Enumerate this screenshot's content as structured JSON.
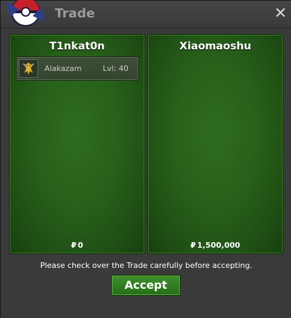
{
  "window": {
    "title": "Trade",
    "close_icon": "close-icon",
    "logo_icon": "pokeball-logo-icon"
  },
  "trade": {
    "left": {
      "player": "T1nkat0n",
      "items": [
        {
          "name": "Alakazam",
          "level": "Lvl: 40",
          "icon": "alakazam-sprite-icon"
        }
      ],
      "currency_symbol": "₽",
      "money": "0"
    },
    "right": {
      "player": "Xiaomaoshu",
      "items": [],
      "currency_symbol": "₽",
      "money": "1,500,000"
    }
  },
  "notice": "Please check over the Trade carefully before accepting.",
  "accept_label": "Accept",
  "colors": {
    "panel_green": "#27601a",
    "accept_green": "#2f7d21",
    "window_bg": "#3a3a3a"
  }
}
